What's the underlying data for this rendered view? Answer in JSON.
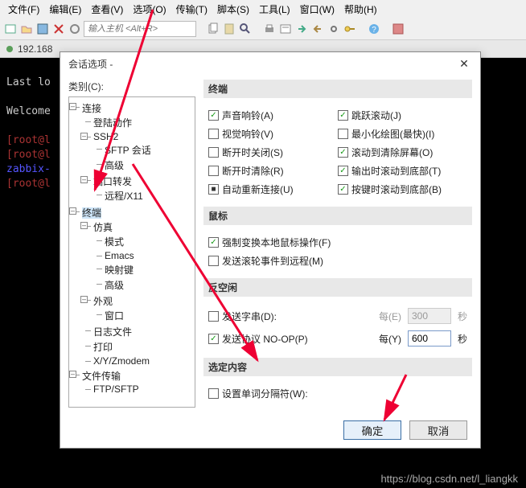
{
  "menubar": [
    "文件(F)",
    "编辑(E)",
    "查看(V)",
    "选项(O)",
    "传输(T)",
    "脚本(S)",
    "工具(L)",
    "窗口(W)",
    "帮助(H)"
  ],
  "toolbar": {
    "host_placeholder": "输入主机 <Alt+R>"
  },
  "tabbar": {
    "ip": "192.168"
  },
  "terminal": {
    "l1": "Last lo",
    "l2": "Welcome",
    "l3": "[root@l",
    "l4": "[root@l",
    "l5": "zabbix-",
    "l6": "[root@l"
  },
  "dialog": {
    "title": "会话选项 - ",
    "tree_label": "类别(C):",
    "tree": {
      "conn": "连接",
      "login": "登陆动作",
      "ssh2": "SSH2",
      "sftp": "SFTP 会话",
      "hl1": "高级",
      "portfwd": "端口转发",
      "remote": "远程/X11",
      "term": "终端",
      "emu": "仿真",
      "mode": "模式",
      "emacs": "Emacs",
      "keymap": "映射键",
      "hl2": "高级",
      "look": "外观",
      "win": "窗口",
      "logf": "日志文件",
      "print": "打印",
      "xyz": "X/Y/Zmodem",
      "fx": "文件传输",
      "ftp": "FTP/SFTP"
    },
    "sections": {
      "terminal": "终端",
      "mouse": "鼠标",
      "antiidle": "反空闲",
      "selection": "选定内容"
    },
    "opts": {
      "bell_a": "声音响铃(A)",
      "jump": "跳跃滚动(J)",
      "bell_v": "视觉响铃(V)",
      "mindraw": "最小化绘图(最快)(I)",
      "close_s": "断开时关闭(S)",
      "scroll_clear": "滚动到清除屏幕(O)",
      "clear_r": "断开时清除(R)",
      "scroll_out": "输出时滚动到底部(T)",
      "autoreconn": "自动重新连接(U)",
      "scroll_key": "按键时滚动到底部(B)",
      "force_mouse": "强制变换本地鼠标操作(F)",
      "send_wheel": "发送滚轮事件到远程(M)",
      "send_str": "发送字串(D):",
      "send_proto": "发送协议  NO-OP(P)",
      "word_sep": "设置单词分隔符(W):"
    },
    "labels": {
      "every_e": "每(E)",
      "every_y": "每(Y)",
      "sec": "秒"
    },
    "values": {
      "interval_e": "300",
      "interval_y": "600"
    },
    "buttons": {
      "ok": "确定",
      "cancel": "取消"
    }
  },
  "watermark": "https://blog.csdn.net/l_liangkk"
}
